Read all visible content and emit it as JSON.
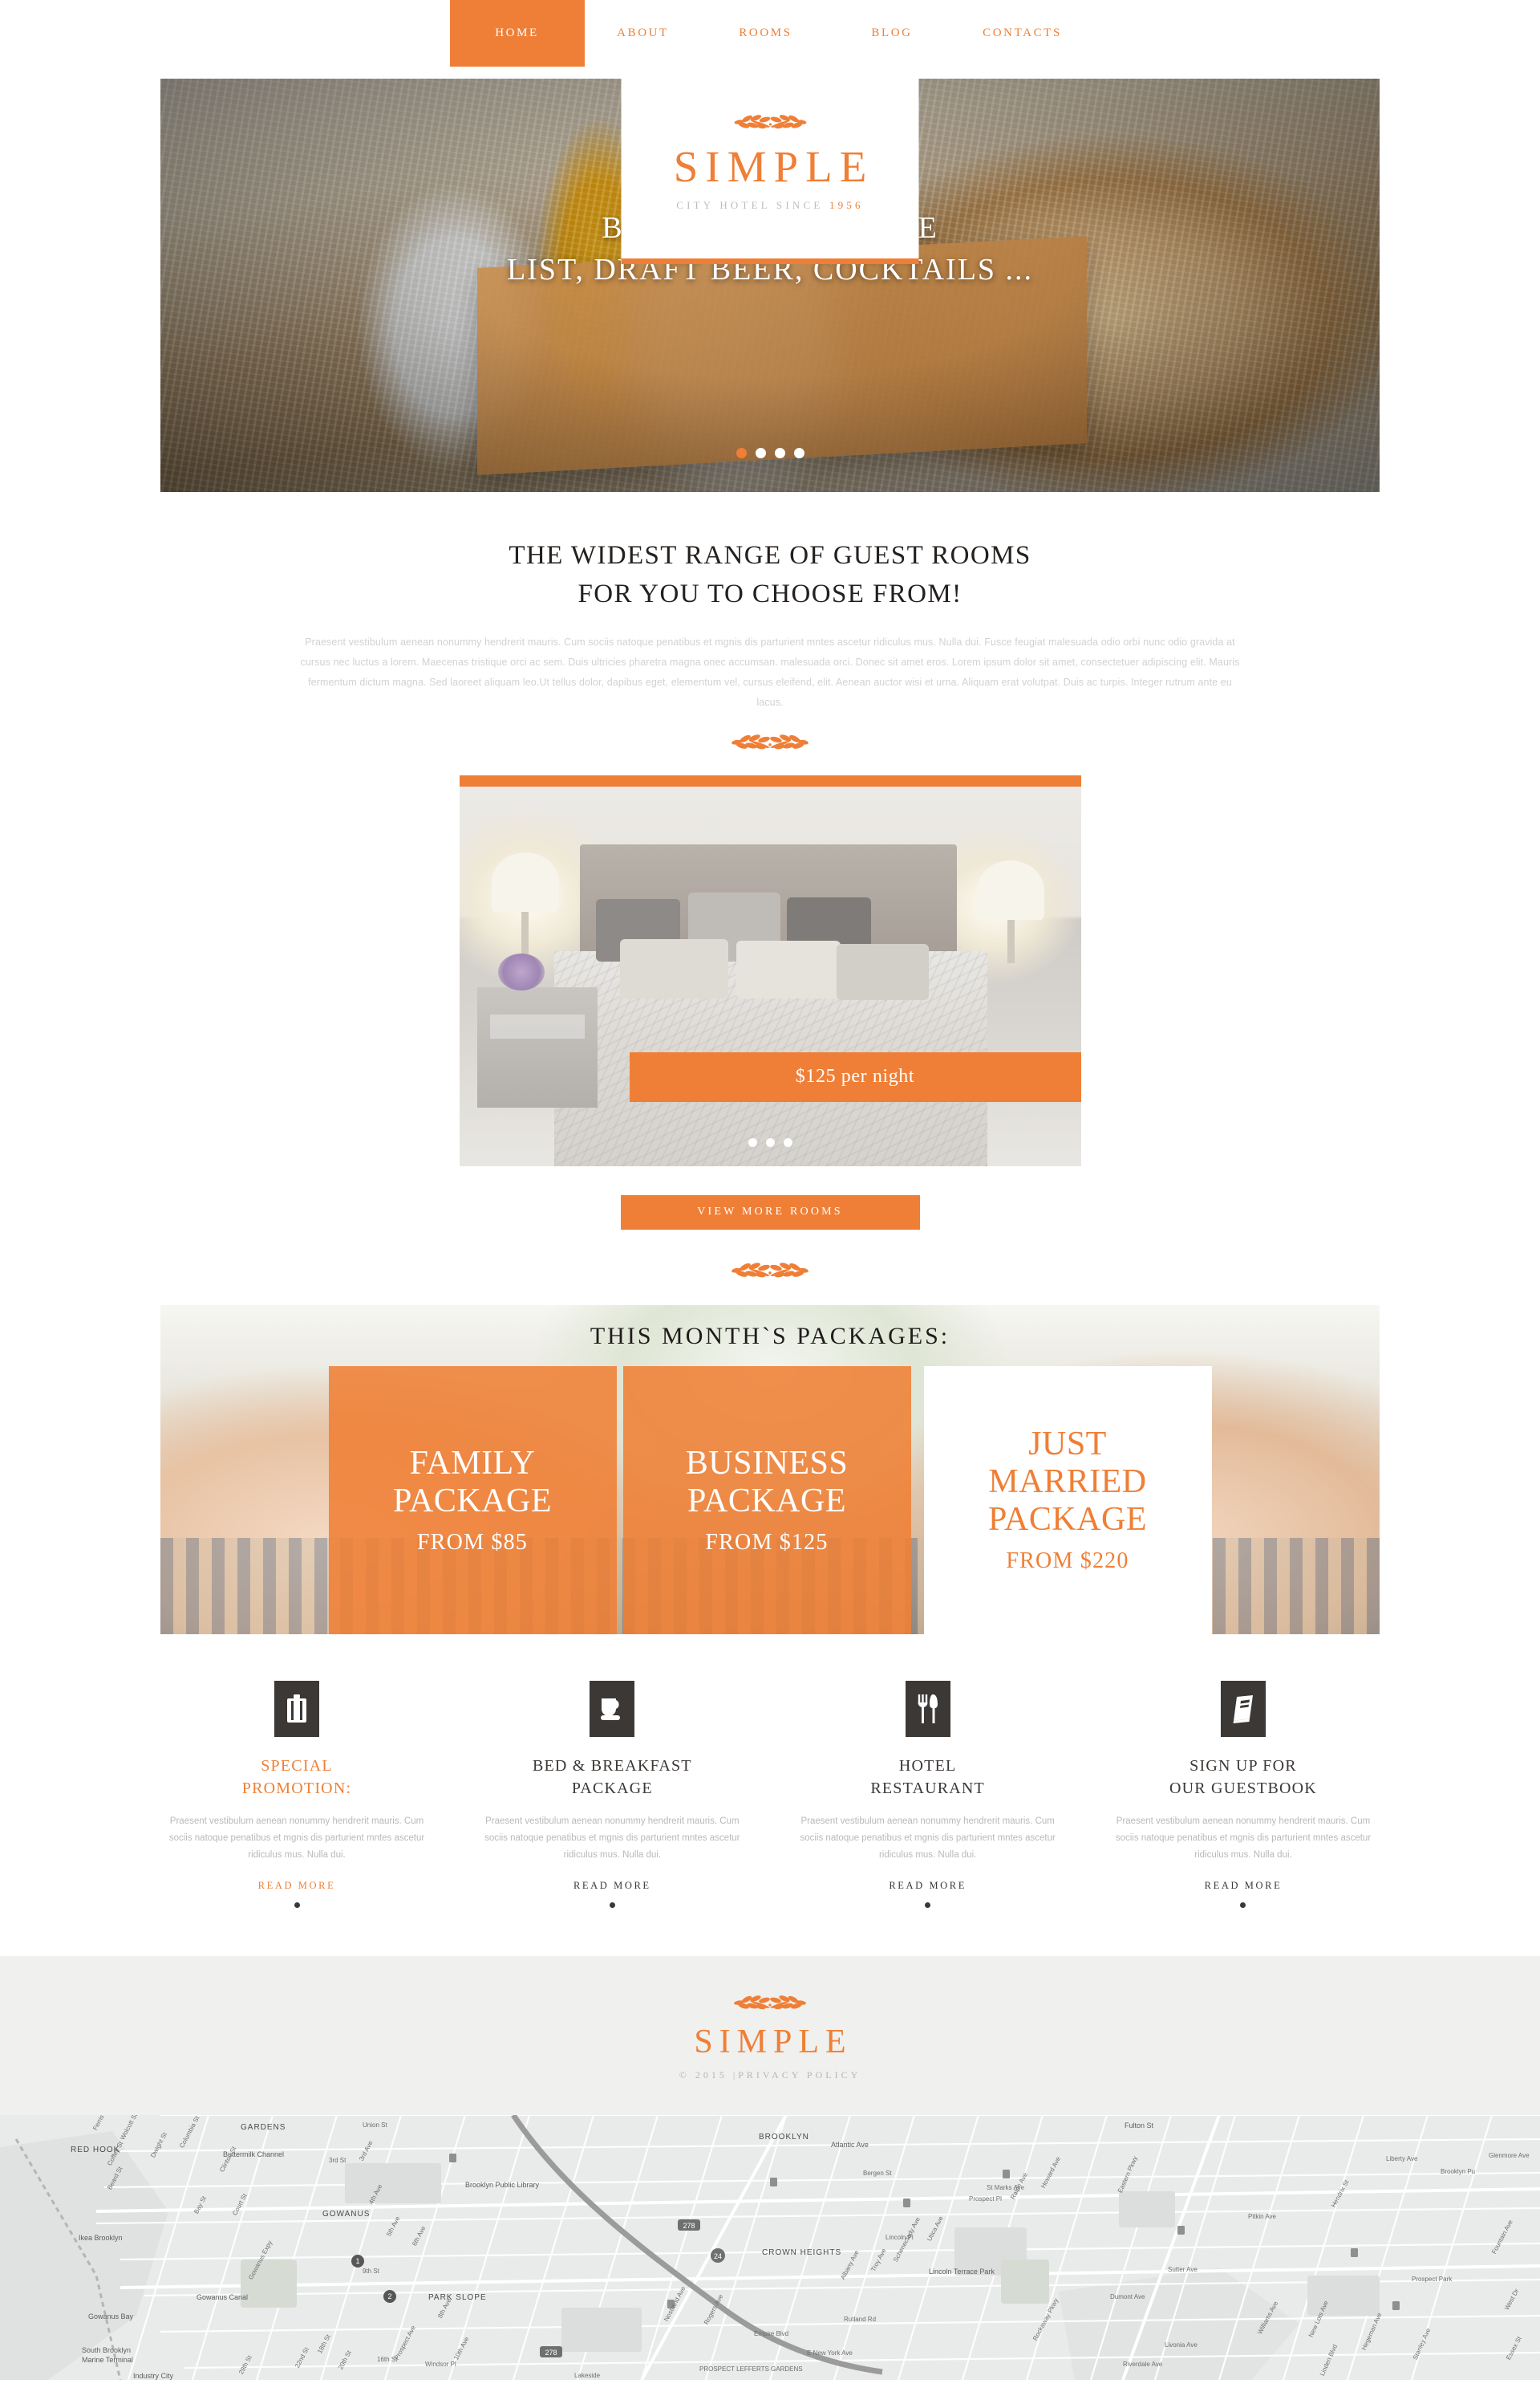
{
  "nav": {
    "items": [
      {
        "label": "HOME",
        "active": true
      },
      {
        "label": "ABOUT",
        "active": false
      },
      {
        "label": "ROOMS",
        "active": false
      },
      {
        "label": "BLOG",
        "active": false
      },
      {
        "label": "CONTACTS",
        "active": false
      }
    ]
  },
  "logo": {
    "word": "SIMPLE",
    "tagline_text": "CITY HOTEL SINCE ",
    "tagline_year": "1956"
  },
  "hero": {
    "caption_line1": "BEST COOKING,WINE",
    "caption_line2": "LIST, DRAFT BEER, COCKTAILS ...",
    "dots": 4,
    "active_dot": 0
  },
  "intro": {
    "heading_line1": "THE WIDEST RANGE OF GUEST ROOMS",
    "heading_line2": "FOR YOU TO CHOOSE FROM!",
    "paragraph": "Praesent vestibulum aenean nonummy hendrerit mauris. Cum sociis natoque penatibus et mgnis dis parturient mntes ascetur ridiculus mus. Nulla dui. Fusce feugiat malesuada odio orbi nunc odio gravida at cursus nec luctus a lorem. Maecenas tristique orci ac sem. Duis ultricies pharetra magna onec accumsan. malesuada orci. Donec sit amet eros. Lorem ipsum dolor sit amet, consectetuer adipiscing elit. Mauris fermentum dictum magna. Sed laoreet aliquam leo.Ut tellus dolor, dapibus eget, elementum vel, cursus eleifend, elit. Aenean auctor wisi et urna. Aliquam erat volutpat. Duis ac turpis. Integer rutrum ante eu lacus."
  },
  "rooms": {
    "price_label": "$125 per night",
    "dots": 3,
    "active_dot": 2,
    "view_more_label": "VIEW MORE ROOMS"
  },
  "packages": {
    "title": "THIS MONTH`S PACKAGES:",
    "cards": [
      {
        "name_line1": "FAMILY",
        "name_line2": "PACKAGE",
        "price": "FROM $85",
        "style": "orange"
      },
      {
        "name_line1": "BUSINESS",
        "name_line2": "PACKAGE",
        "price": "FROM $125",
        "style": "orange"
      },
      {
        "name_line1": "JUST",
        "name_line2": "MARRIED",
        "name_line3": "PACKAGE",
        "price": "FROM $220",
        "style": "white"
      }
    ]
  },
  "features": {
    "body": "Praesent vestibulum aenean nonummy hendrerit mauris. Cum sociis natoque penatibus et mgnis dis parturient mntes ascetur ridiculus mus. Nulla dui.",
    "read_more_label": "READ MORE",
    "items": [
      {
        "icon": "suitcase-icon",
        "title_line1": "SPECIAL",
        "title_line2": "PROMOTION:",
        "highlighted": true
      },
      {
        "icon": "coffee-cup-icon",
        "title_line1": "BED & BREAKFAST",
        "title_line2": "PACKAGE",
        "highlighted": false
      },
      {
        "icon": "cutlery-icon",
        "title_line1": "HOTEL",
        "title_line2": "RESTAURANT",
        "highlighted": false
      },
      {
        "icon": "book-icon",
        "title_line1": "SIGN UP FOR",
        "title_line2": "OUR GUESTBOOK",
        "highlighted": false
      }
    ]
  },
  "footer": {
    "word": "SIMPLE",
    "copyright": "© 2015 |PRIVACY POLICY"
  },
  "map": {
    "labels": [
      "GARDENS",
      "RED HOOK",
      "Buttermilk Channel",
      "BROOKLYN",
      "GOWANUS",
      "PARK SLOPE",
      "Ikea Brooklyn",
      "Gowanus Canal",
      "Gowanus Bay",
      "South Brooklyn",
      "Marine Terminal",
      "Industry City",
      "Brooklyn Public Library",
      "Lincoln Terrace Park",
      "CROWN HEIGHTS",
      "Prospect Park",
      "Ferris St",
      "Wolcott St",
      "Coffey St",
      "Dwight St",
      "Beard St",
      "Columbia St",
      "Clinton St",
      "Court St",
      "Bay St",
      "Union St",
      "3rd St",
      "3rd Ave",
      "4th Ave",
      "5th Ave",
      "6th Ave",
      "8th Ave",
      "9th St",
      "10th Ave",
      "16th St",
      "18th St",
      "20th St",
      "22nd St",
      "29th St",
      "Gowanus Expy",
      "Prospect Ave",
      "Windsor Pl",
      "Atlantic Ave",
      "Fulton St",
      "Bergen St",
      "St Marks Ave",
      "Prospect Pl",
      "Eastern Pkwy",
      "Lincoln Pl",
      "Utica Ave",
      "Ralph Ave",
      "Howard Ave",
      "Troy Ave",
      "Schenectady Ave",
      "Albany Ave",
      "E New York Ave",
      "Rockaway Pkwy",
      "Pitkin Ave",
      "Sutter Ave",
      "Dumont Ave",
      "Livonia Ave",
      "Riverdale Ave",
      "New Lots Ave",
      "Hegeman Ave",
      "Stanley Ave",
      "Linden Blvd",
      "Williams Ave",
      "Hendrix St",
      "Liberty Ave",
      "Glenmore Ave",
      "Fountain Ave",
      "Essex St",
      "Rutland Rd",
      "West Dr",
      "Empire Blvd",
      "Rogers Ave",
      "Nostrand Ave",
      "Lakeside",
      "PROSPECT LEFFERTS GARDENS",
      "278",
      "24",
      "Brooklyn Pu"
    ],
    "pins": [
      "1",
      "2"
    ]
  },
  "colors": {
    "accent": "#ef7f36",
    "dark": "#3b3836",
    "muted": "#bdbdbd",
    "footer_bg": "#f0f0ee"
  }
}
